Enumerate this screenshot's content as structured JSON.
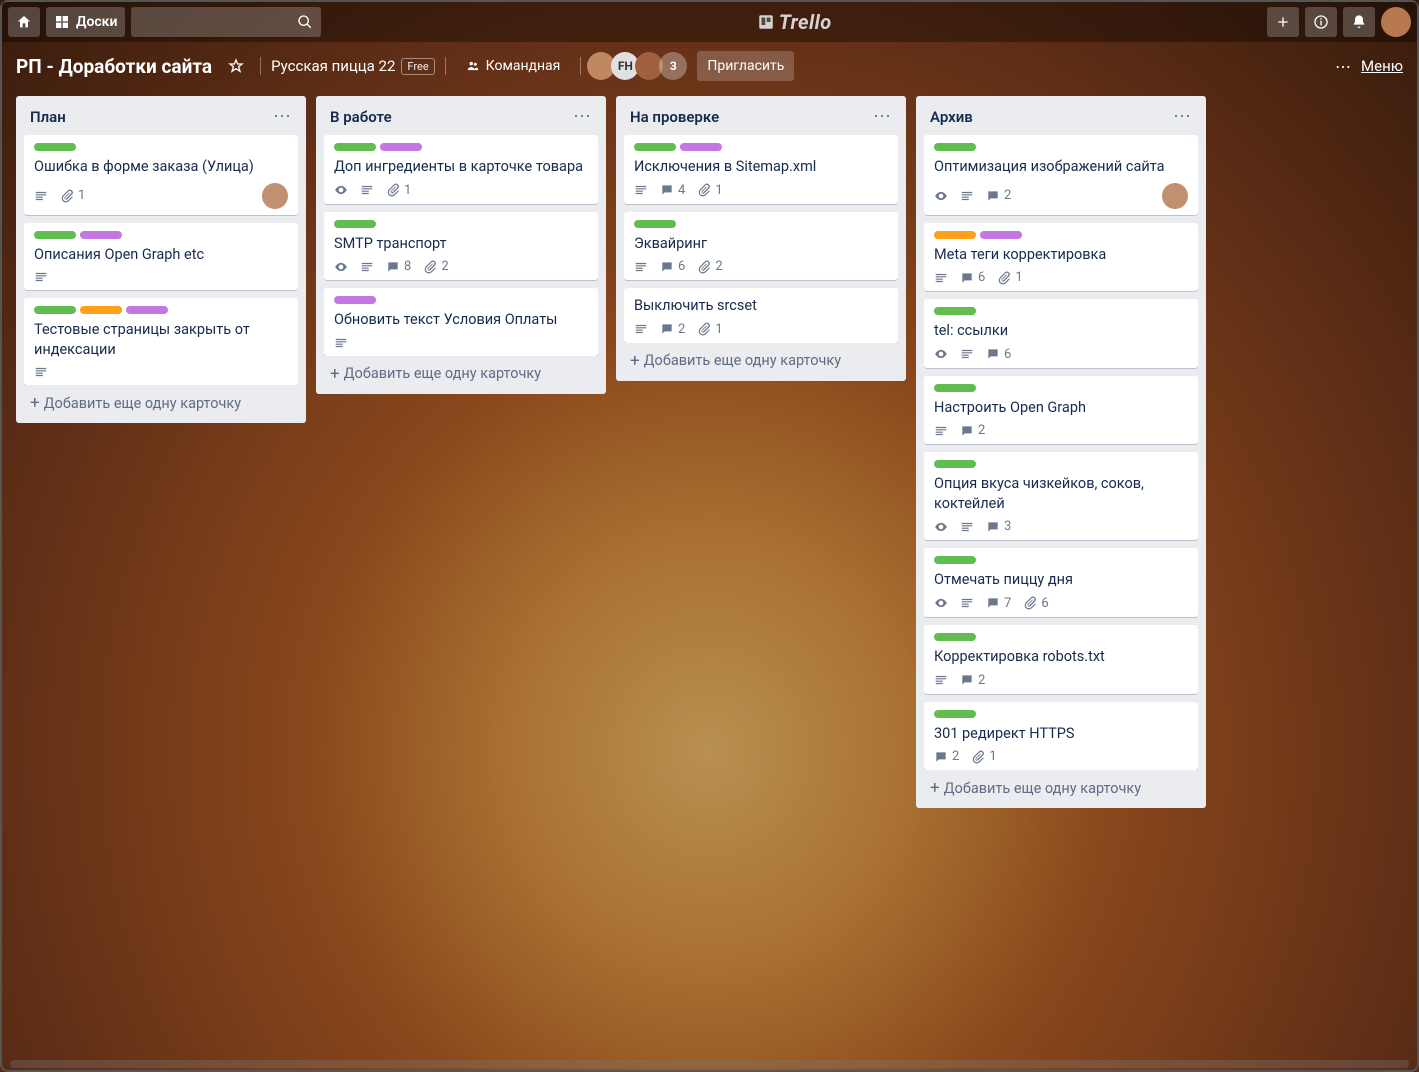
{
  "app": {
    "name": "Trello"
  },
  "header": {
    "boards_label": "Доски",
    "search_placeholder": ""
  },
  "board_bar": {
    "title": "РП - Доработки сайта",
    "team": "Русская пицца 22",
    "plan_badge": "Free",
    "visibility": "Командная",
    "member_initials": "FH",
    "extra_members": "3",
    "invite": "Пригласить",
    "menu": "Меню"
  },
  "add_card_label": "Добавить еще одну карточку",
  "lists": [
    {
      "title": "План",
      "cards": [
        {
          "labels": [
            "lg"
          ],
          "title": "Ошибка в форме заказа (Улица)",
          "desc": true,
          "attachments": 1,
          "member": true
        },
        {
          "labels": [
            "lg",
            "lp"
          ],
          "title": "Описания Open Graph etc",
          "desc": true
        },
        {
          "labels": [
            "lg",
            "lo",
            "lp"
          ],
          "title": "Тестовые страницы закрыть от индексации",
          "desc": true
        }
      ]
    },
    {
      "title": "В работе",
      "cards": [
        {
          "labels": [
            "lg",
            "lp"
          ],
          "title": "Доп ингредиенты в карточке товара",
          "watch": true,
          "desc": true,
          "attachments": 1
        },
        {
          "labels": [
            "lg"
          ],
          "title": "SMTP транспорт",
          "watch": true,
          "desc": true,
          "comments": 8,
          "attachments": 2
        },
        {
          "labels": [
            "lp"
          ],
          "title": "Обновить текст Условия Оплаты",
          "desc": true
        }
      ]
    },
    {
      "title": "На проверке",
      "cards": [
        {
          "labels": [
            "lg",
            "lp"
          ],
          "title": "Исключения в Sitemap.xml",
          "desc": true,
          "comments": 4,
          "attachments": 1
        },
        {
          "labels": [
            "lg"
          ],
          "title": "Эквайринг",
          "desc": true,
          "comments": 6,
          "attachments": 2
        },
        {
          "title": "Выключить srcset",
          "desc": true,
          "comments": 2,
          "attachments": 1
        }
      ]
    },
    {
      "title": "Архив",
      "cards": [
        {
          "labels": [
            "lg"
          ],
          "title": "Оптимизация изображений сайта",
          "watch": true,
          "desc": true,
          "comments": 2,
          "member": true
        },
        {
          "labels": [
            "lo",
            "lp"
          ],
          "title": "Meta теги корректировка",
          "desc": true,
          "comments": 6,
          "attachments": 1
        },
        {
          "labels": [
            "lg"
          ],
          "title": "tel: ссылки",
          "watch": true,
          "desc": true,
          "comments": 6
        },
        {
          "labels": [
            "lg"
          ],
          "title": "Настроить Open Graph",
          "desc": true,
          "comments": 2
        },
        {
          "labels": [
            "lg"
          ],
          "title": "Опция вкуса чизкейков, соков, коктейлей",
          "watch": true,
          "desc": true,
          "comments": 3
        },
        {
          "labels": [
            "lg"
          ],
          "title": "Отмечать пиццу дня",
          "watch": true,
          "desc": true,
          "comments": 7,
          "attachments": 6
        },
        {
          "labels": [
            "lg"
          ],
          "title": "Корректировка robots.txt",
          "desc": true,
          "comments": 2
        },
        {
          "labels": [
            "lg"
          ],
          "title": "301 редирект HTTPS",
          "comments": 2,
          "attachments": 1
        }
      ]
    }
  ]
}
